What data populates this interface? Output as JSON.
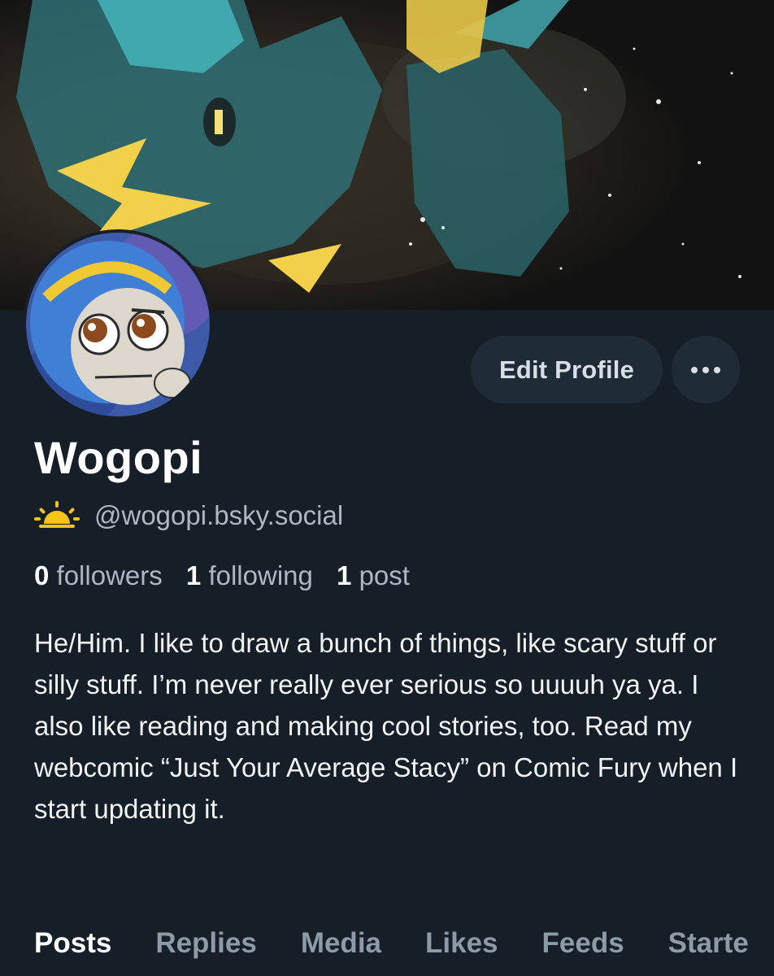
{
  "profile": {
    "display_name": "Wogopi",
    "handle": "@wogopi.bsky.social",
    "bio": "He/Him. I like to draw a bunch of things, like scary stuff or silly stuff. I’m never really ever serious so uuuuh ya ya. I also like reading and making cool stories, too. Read my webcomic “Just Your Average Stacy” on Comic Fury when I start updating it.",
    "badge_icon": "sun-icon"
  },
  "stats": {
    "followers_count": "0",
    "followers_label": "followers",
    "following_count": "1",
    "following_label": "following",
    "posts_count": "1",
    "posts_label": "post"
  },
  "actions": {
    "edit_label": "Edit Profile",
    "more_icon": "more-horizontal-icon"
  },
  "tabs": [
    {
      "label": "Posts",
      "active": true
    },
    {
      "label": "Replies",
      "active": false
    },
    {
      "label": "Media",
      "active": false
    },
    {
      "label": "Likes",
      "active": false
    },
    {
      "label": "Feeds",
      "active": false
    },
    {
      "label": "Starte",
      "active": false
    }
  ],
  "colors": {
    "background": "#161e27",
    "button_bg": "#1f2b37",
    "muted_text": "#aeb8c3",
    "inactive_tab": "#8d9aa8",
    "badge": "#f5c518"
  }
}
